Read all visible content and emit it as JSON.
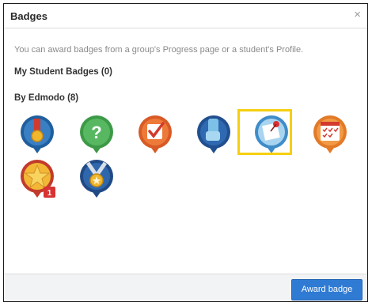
{
  "dialog": {
    "title": "Badges",
    "close_glyph": "×",
    "intro": "You can award badges from a group's Progress page or a student's Profile.",
    "my_badges_heading": "My Student Badges (0)",
    "by_edmodo_heading": "By Edmodo (8)",
    "award_button": "Award badge"
  },
  "badges": [
    {
      "icon": "medal-badge-icon",
      "color": "#1f5f9e",
      "selected": false
    },
    {
      "icon": "question-badge-icon",
      "color": "#3c9a47",
      "selected": false
    },
    {
      "icon": "checkmark-badge-icon",
      "color": "#d85a25",
      "selected": false
    },
    {
      "icon": "thumbs-up-badge-icon",
      "color": "#214f8f",
      "selected": false
    },
    {
      "icon": "note-pin-badge-icon",
      "color": "#3f8cc9",
      "selected": true
    },
    {
      "icon": "calendar-badge-icon",
      "color": "#e27a28",
      "selected": false
    },
    {
      "icon": "star-badge-icon",
      "color": "#c23b2c",
      "count": "1",
      "selected": false
    },
    {
      "icon": "star-medal-badge-icon",
      "color": "#204a86",
      "selected": false
    }
  ]
}
